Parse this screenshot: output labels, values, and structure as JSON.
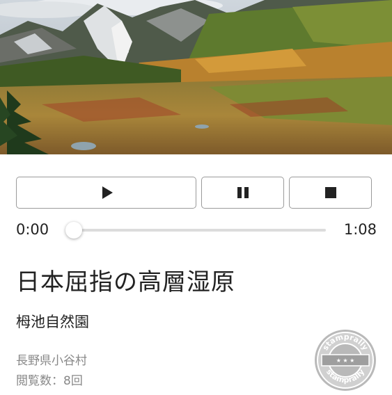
{
  "hero": {
    "alt": "alpine wetland with autumn colors and mountains"
  },
  "player": {
    "play_icon": "play-icon",
    "pause_icon": "pause-icon",
    "stop_icon": "stop-icon",
    "current_time": "0:00",
    "total_time": "1:08",
    "progress": 0
  },
  "spot": {
    "title": "日本屈指の高層湿原",
    "name": "栂池自然園",
    "location": "長野県小谷村",
    "views_label": "閲覧数：",
    "views_count": "8回"
  },
  "stamp": {
    "top_text": "stamprally",
    "bottom_text": "stamprally",
    "icon": "stamp-badge-icon"
  },
  "colors": {
    "button_border": "#9a9a9a",
    "track": "#dcdcdc",
    "muted_text": "#888888"
  }
}
